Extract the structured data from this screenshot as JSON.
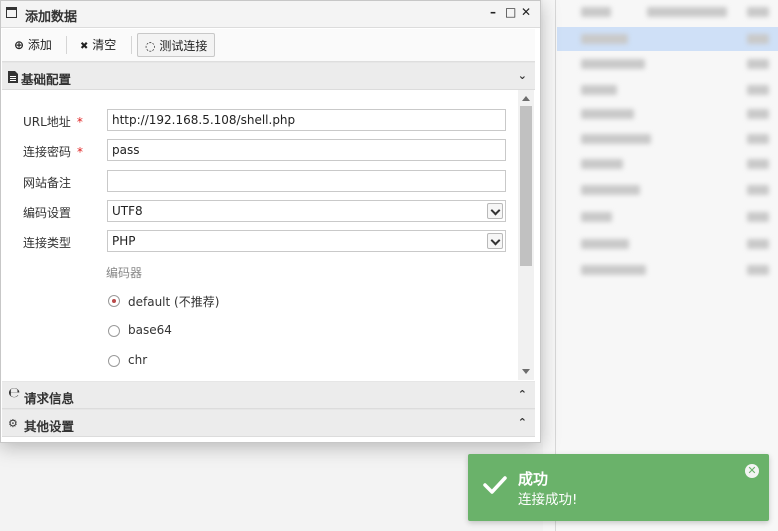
{
  "window": {
    "title": "添加数据",
    "controls": {
      "minimize": "–",
      "maximize": "□",
      "close": "✕"
    }
  },
  "toolbar": {
    "add_label": "添加",
    "add_icon": "⊕",
    "clear_label": "清空",
    "clear_icon": "✖",
    "test_label": "测试连接",
    "test_icon": "◌"
  },
  "sections": {
    "basic": {
      "title": "基础配置",
      "icon": "file-icon"
    },
    "request": {
      "title": "请求信息",
      "icon": "ie-icon"
    },
    "other": {
      "title": "其他设置",
      "icon": "gears-icon"
    }
  },
  "form": {
    "url": {
      "label": "URL地址",
      "required": "*",
      "value": "http://192.168.5.108/shell.php"
    },
    "password": {
      "label": "连接密码",
      "required": "*",
      "value": "pass"
    },
    "note": {
      "label": "网站备注",
      "value": ""
    },
    "encoding": {
      "label": "编码设置",
      "value": "UTF8"
    },
    "type": {
      "label": "连接类型",
      "value": "PHP"
    },
    "encoder": {
      "label": "编码器",
      "options": [
        {
          "label": "default (不推荐)",
          "selected": true
        },
        {
          "label": "base64",
          "selected": false
        },
        {
          "label": "chr",
          "selected": false
        }
      ]
    }
  },
  "toast": {
    "title": "成功",
    "message": "连接成功!",
    "color": "#6ab26a",
    "close": "✕"
  }
}
